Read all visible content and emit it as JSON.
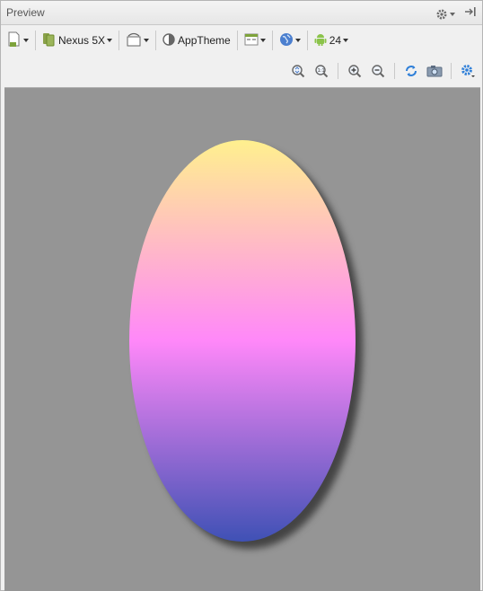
{
  "panel": {
    "title": "Preview"
  },
  "toolbar": {
    "device": "Nexus 5X",
    "theme": "AppTheme",
    "api_level": "24"
  },
  "icons": {
    "settings": "gear-icon",
    "hide": "pin-icon",
    "design_mode": "design-surface-icon",
    "orientation": "orientation-icon",
    "theme": "theme-icon",
    "activity": "activity-layout-icon",
    "locale": "globe-icon",
    "android": "android-icon",
    "zoom_fit": "zoom-fit-icon",
    "zoom_actual": "zoom-actual-icon",
    "zoom_in": "zoom-in-icon",
    "zoom_out": "zoom-out-icon",
    "refresh": "refresh-icon",
    "screenshot": "camera-icon",
    "options": "options-gear-icon"
  },
  "drawable": {
    "shape": "oval",
    "gradient": [
      "#FFF08E",
      "#FF88F9",
      "#3F51B5"
    ],
    "background": "#959595"
  }
}
